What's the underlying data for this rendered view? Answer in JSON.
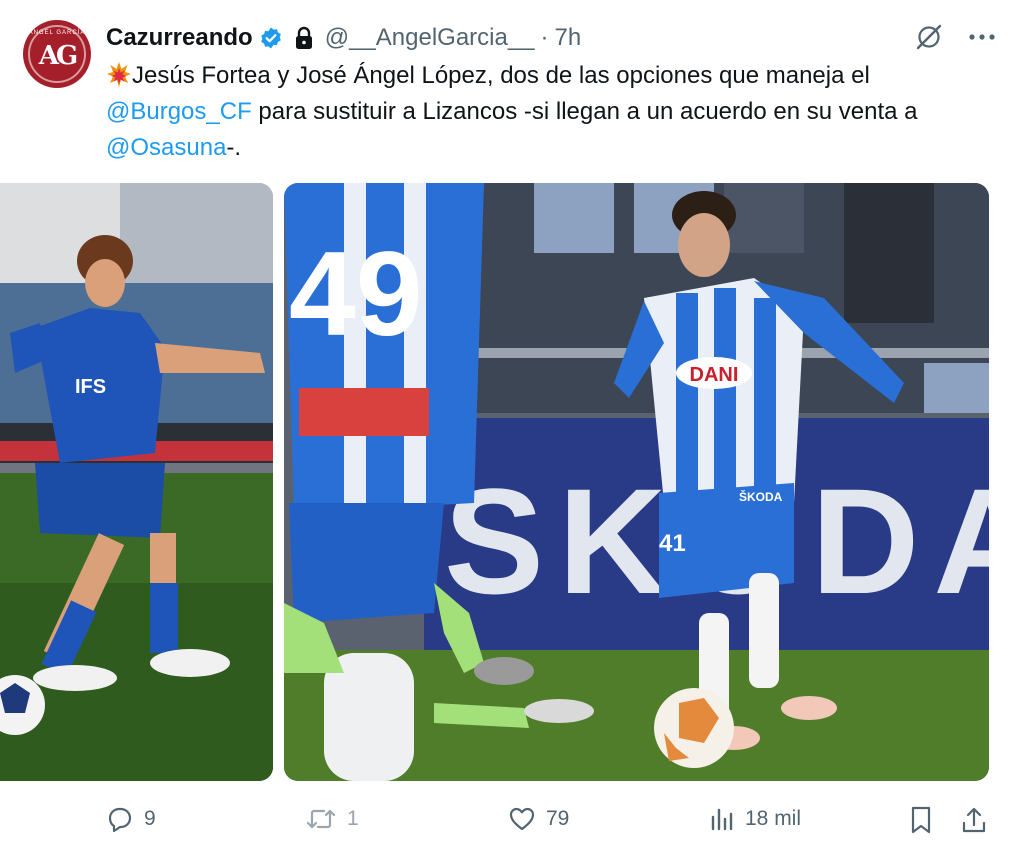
{
  "author": {
    "name": "Cazurreando",
    "handle": "@__AngelGarcia__",
    "separator": "·",
    "time": "7h",
    "avatar_text": "AG",
    "avatar_arc_text": "ÁNGEL GARCÍA",
    "avatar_color": "#a51f2b"
  },
  "tweet": {
    "emoji": "collision-emoji",
    "text_1": "Jesús Fortea y José Ángel López, dos de las opciones que maneja el",
    "mention_1": "@Burgos_CF",
    "text_2": " para sustituir a Lizancos -si llegan a un acuerdo en su venta a",
    "mention_2": "@Osasuna",
    "text_3": "-."
  },
  "media": {
    "left_photo": {
      "shirt_text": "IFS"
    },
    "right_photo": {
      "back_number": "49",
      "player_number": "41",
      "sponsor": "DANI",
      "board_text": "SKODA",
      "shorts_text": "ŠKODA"
    }
  },
  "actions": {
    "replies": "9",
    "reposts": "1",
    "likes": "79",
    "views": "18 mil"
  },
  "colors": {
    "accent": "#1d9bf0",
    "muted": "#536471",
    "text": "#0f1419"
  }
}
